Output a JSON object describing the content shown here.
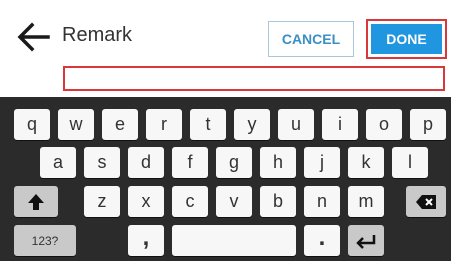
{
  "header": {
    "title": "Remark",
    "cancel_label": "CANCEL",
    "done_label": "DONE",
    "back_icon": "arrow-left-icon"
  },
  "remark_input": {
    "value": "",
    "placeholder": ""
  },
  "keyboard": {
    "row1": [
      "q",
      "w",
      "e",
      "r",
      "t",
      "y",
      "u",
      "i",
      "o",
      "p"
    ],
    "row2": [
      "a",
      "s",
      "d",
      "f",
      "g",
      "h",
      "j",
      "k",
      "l"
    ],
    "row3": [
      "z",
      "x",
      "c",
      "v",
      "b",
      "n",
      "m"
    ],
    "shift_icon": "shift-arrow-icon",
    "backspace_icon": "backspace-icon",
    "symbols_label": "123?",
    "comma_label": ",",
    "period_label": ".",
    "enter_icon": "enter-return-icon"
  },
  "colors": {
    "accent": "#2196e0",
    "highlight_border": "#d9383a",
    "keyboard_bg": "#2b2b2b",
    "key_bg": "#f7f7f7",
    "modifier_key_bg": "#c9c9c9"
  }
}
